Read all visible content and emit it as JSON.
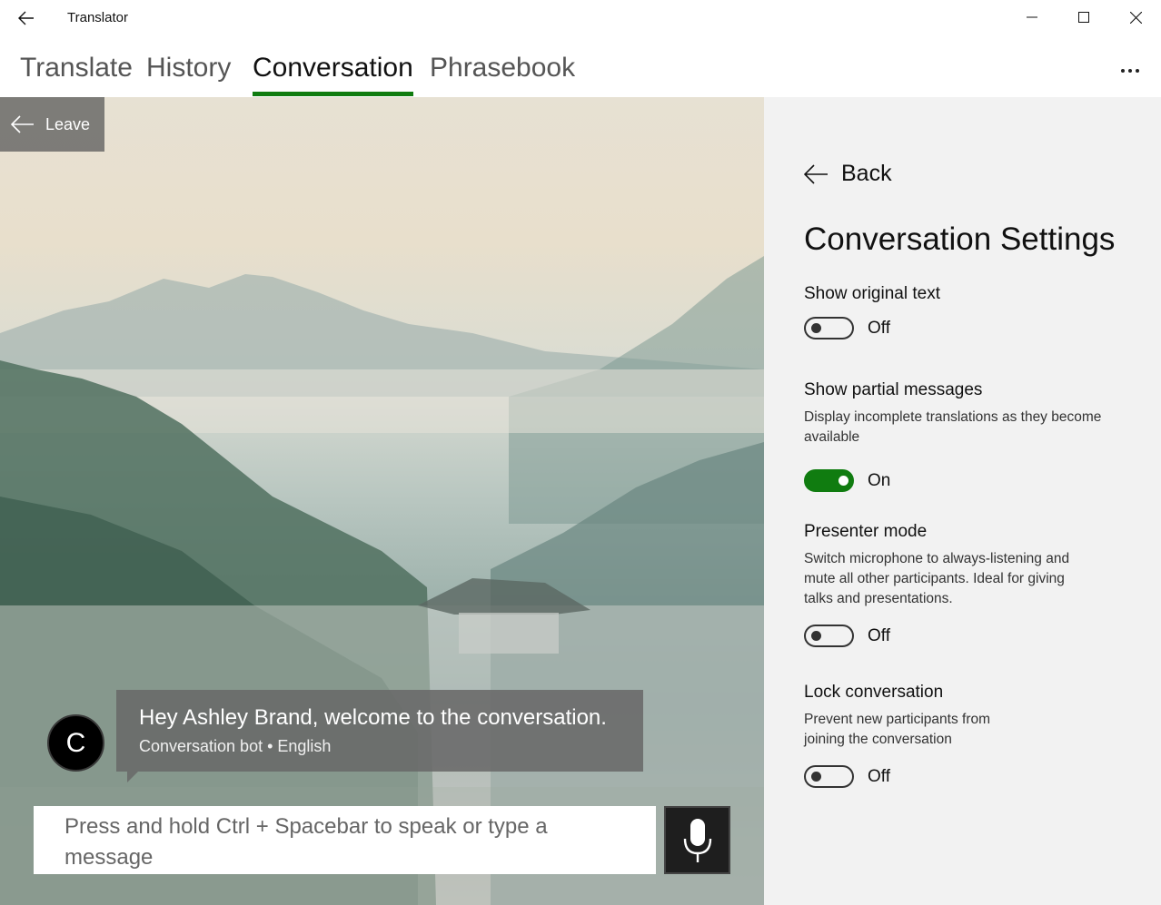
{
  "window": {
    "title": "Translator"
  },
  "tabs": [
    {
      "label": "Translate",
      "active": false
    },
    {
      "label": "History",
      "active": false
    },
    {
      "label": "Conversation",
      "active": true
    },
    {
      "label": "Phrasebook",
      "active": false
    }
  ],
  "conversation": {
    "leave_label": "Leave",
    "avatar_initial": "C",
    "message_text": "Hey Ashley Brand, welcome to the conversation.",
    "message_meta": "Conversation bot • English",
    "input_placeholder": "Press and hold Ctrl + Spacebar to speak or type a message"
  },
  "settings": {
    "back_label": "Back",
    "title": "Conversation Settings",
    "items": [
      {
        "label": "Show original text",
        "description": "",
        "state": "Off",
        "on": false
      },
      {
        "label": "Show partial messages",
        "description": "Display incomplete translations as they become available",
        "state": "On",
        "on": true
      },
      {
        "label": "Presenter mode",
        "description": "Switch microphone to always-listening and mute all other participants. Ideal for giving talks and presentations.",
        "state": "Off",
        "on": false
      },
      {
        "label": "Lock conversation",
        "description": "Prevent new participants from joining the conversation",
        "state": "Off",
        "on": false
      }
    ]
  },
  "colors": {
    "accent": "#107c10",
    "settings_bg": "#f2f2f2"
  }
}
